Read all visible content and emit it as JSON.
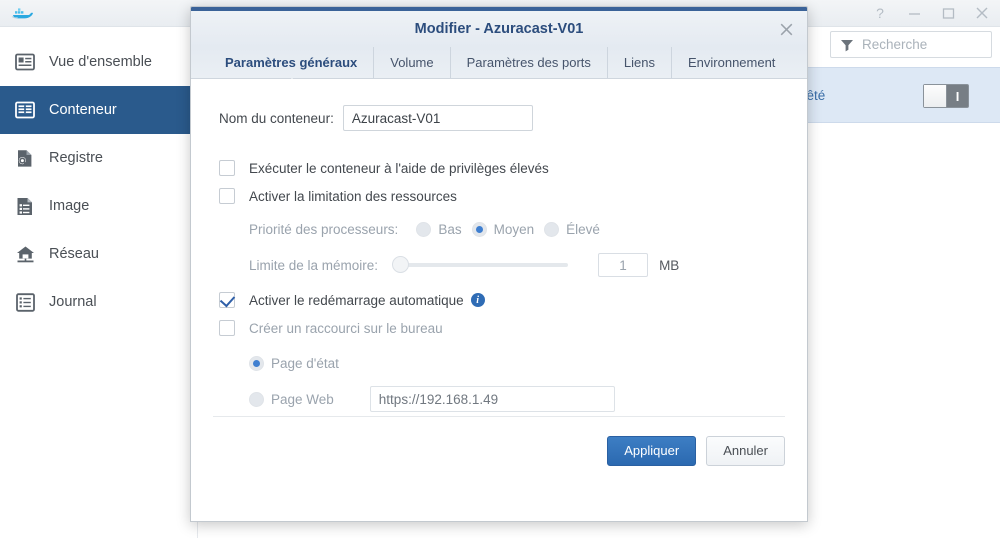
{
  "app": {
    "logo_icon": "docker-whale-icon",
    "window_controls": [
      {
        "name": "help-button",
        "glyph": "?"
      },
      {
        "name": "minimize-button",
        "glyph": "−"
      },
      {
        "name": "maximize-button",
        "glyph": "□"
      },
      {
        "name": "close-button",
        "glyph": "×"
      }
    ]
  },
  "sidebar": {
    "items": [
      {
        "label": "Vue d'ensemble",
        "icon": "overview-icon",
        "active": false
      },
      {
        "label": "Conteneur",
        "icon": "container-icon",
        "active": true
      },
      {
        "label": "Registre",
        "icon": "registry-icon",
        "active": false
      },
      {
        "label": "Image",
        "icon": "image-icon",
        "active": false
      },
      {
        "label": "Réseau",
        "icon": "network-icon",
        "active": false
      },
      {
        "label": "Journal",
        "icon": "log-icon",
        "active": false
      }
    ]
  },
  "background": {
    "search": {
      "placeholder": "Recherche",
      "icon": "filter-funnel-icon"
    },
    "row": {
      "status_text": "rêté",
      "toggle_glyph": "I"
    }
  },
  "dialog": {
    "title": "Modifier - Azuracast-V01",
    "close_glyph": "×",
    "tabs": [
      {
        "label": "Paramètres généraux",
        "active": true
      },
      {
        "label": "Volume",
        "active": false
      },
      {
        "label": "Paramètres des ports",
        "active": false
      },
      {
        "label": "Liens",
        "active": false
      },
      {
        "label": "Environnement",
        "active": false
      }
    ],
    "form": {
      "name_label": "Nom du conteneur:",
      "name_value": "Azuracast-V01",
      "privileged_label": "Exécuter le conteneur à l'aide de privilèges élevés",
      "privileged_checked": false,
      "resource_limit_label": "Activer la limitation des ressources",
      "resource_limit_checked": false,
      "cpu_priority_label": "Priorité des processeurs:",
      "cpu_priority_options": [
        {
          "label": "Bas",
          "selected": false
        },
        {
          "label": "Moyen",
          "selected": true
        },
        {
          "label": "Élevé",
          "selected": false
        }
      ],
      "memory_limit_label": "Limite de la mémoire:",
      "memory_value": "1",
      "memory_unit": "MB",
      "auto_restart_label": "Activer le redémarrage automatique",
      "auto_restart_checked": true,
      "auto_restart_info_icon": "info-icon",
      "shortcut_label": "Créer un raccourci sur le bureau",
      "shortcut_checked": false,
      "shortcut_options": [
        {
          "label": "Page d'état",
          "selected": true
        },
        {
          "label": "Page Web",
          "selected": false
        }
      ],
      "web_url_value": "https://192.168.1.49"
    },
    "footer": {
      "apply_label": "Appliquer",
      "cancel_label": "Annuler"
    }
  },
  "colors": {
    "accent_blue": "#2a5a8c",
    "title_blue": "#2c4d7d",
    "primary_button": "#2b69b0",
    "row_highlight": "#dde8f5"
  }
}
